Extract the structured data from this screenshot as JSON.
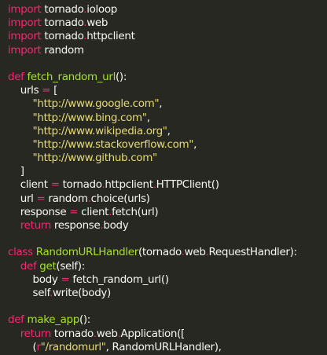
{
  "editor": {
    "theme_colors": {
      "background": "#272822",
      "text": "#f8f8f2",
      "keyword": "#f92672",
      "function": "#a6e22e",
      "string": "#e6db74"
    },
    "lines": [
      [
        [
          "kw",
          "import"
        ],
        [
          "txt",
          " tornado"
        ],
        [
          "dot",
          "."
        ],
        [
          "txt",
          "ioloop"
        ]
      ],
      [
        [
          "kw",
          "import"
        ],
        [
          "txt",
          " tornado"
        ],
        [
          "dot",
          "."
        ],
        [
          "txt",
          "web"
        ]
      ],
      [
        [
          "kw",
          "import"
        ],
        [
          "txt",
          " tornado"
        ],
        [
          "dot",
          "."
        ],
        [
          "txt",
          "httpclient"
        ]
      ],
      [
        [
          "kw",
          "import"
        ],
        [
          "txt",
          " random"
        ]
      ],
      [],
      [
        [
          "kw",
          "def"
        ],
        [
          "txt",
          " "
        ],
        [
          "fn",
          "fetch_random_url"
        ],
        [
          "txt",
          "():"
        ]
      ],
      [
        [
          "txt",
          "    urls "
        ],
        [
          "op",
          "="
        ],
        [
          "txt",
          " ["
        ]
      ],
      [
        [
          "txt",
          "        "
        ],
        [
          "str",
          "\"http://www.google.com\""
        ],
        [
          "txt",
          ","
        ]
      ],
      [
        [
          "txt",
          "        "
        ],
        [
          "str",
          "\"http://www.bing.com\""
        ],
        [
          "txt",
          ","
        ]
      ],
      [
        [
          "txt",
          "        "
        ],
        [
          "str",
          "\"http://www.wikipedia.org\""
        ],
        [
          "txt",
          ","
        ]
      ],
      [
        [
          "txt",
          "        "
        ],
        [
          "str",
          "\"http://www.stackoverflow.com\""
        ],
        [
          "txt",
          ","
        ]
      ],
      [
        [
          "txt",
          "        "
        ],
        [
          "str",
          "\"http://www.github.com\""
        ]
      ],
      [
        [
          "txt",
          "    ]"
        ]
      ],
      [
        [
          "txt",
          "    client "
        ],
        [
          "op",
          "="
        ],
        [
          "txt",
          " tornado"
        ],
        [
          "dot",
          "."
        ],
        [
          "txt",
          "httpclient"
        ],
        [
          "dot",
          "."
        ],
        [
          "txt",
          "HTTPClient()"
        ]
      ],
      [
        [
          "txt",
          "    url "
        ],
        [
          "op",
          "="
        ],
        [
          "txt",
          " random"
        ],
        [
          "dot",
          "."
        ],
        [
          "txt",
          "choice(urls)"
        ]
      ],
      [
        [
          "txt",
          "    response "
        ],
        [
          "op",
          "="
        ],
        [
          "txt",
          " client"
        ],
        [
          "dot",
          "."
        ],
        [
          "txt",
          "fetch(url)"
        ]
      ],
      [
        [
          "txt",
          "    "
        ],
        [
          "kw",
          "return"
        ],
        [
          "txt",
          " response"
        ],
        [
          "dot",
          "."
        ],
        [
          "txt",
          "body"
        ]
      ],
      [],
      [
        [
          "kw",
          "class"
        ],
        [
          "txt",
          " "
        ],
        [
          "fn",
          "RandomURLHandler"
        ],
        [
          "txt",
          "(tornado"
        ],
        [
          "dot",
          "."
        ],
        [
          "txt",
          "web"
        ],
        [
          "dot",
          "."
        ],
        [
          "txt",
          "RequestHandler):"
        ]
      ],
      [
        [
          "txt",
          "    "
        ],
        [
          "kw",
          "def"
        ],
        [
          "txt",
          " "
        ],
        [
          "fn",
          "get"
        ],
        [
          "txt",
          "(self):"
        ]
      ],
      [
        [
          "txt",
          "        body "
        ],
        [
          "op",
          "="
        ],
        [
          "txt",
          " fetch_random_url()"
        ]
      ],
      [
        [
          "txt",
          "        self"
        ],
        [
          "dot",
          "."
        ],
        [
          "txt",
          "write(body)"
        ]
      ],
      [],
      [
        [
          "kw",
          "def"
        ],
        [
          "txt",
          " "
        ],
        [
          "fn",
          "make_app"
        ],
        [
          "txt",
          "():"
        ]
      ],
      [
        [
          "txt",
          "    "
        ],
        [
          "kw",
          "return"
        ],
        [
          "txt",
          " tornado"
        ],
        [
          "dot",
          "."
        ],
        [
          "txt",
          "web"
        ],
        [
          "dot",
          "."
        ],
        [
          "txt",
          "Application(["
        ]
      ],
      [
        [
          "txt",
          "        ("
        ],
        [
          "kw",
          "r"
        ],
        [
          "str",
          "\"/randomurl\""
        ],
        [
          "txt",
          ", RandomURLHandler),"
        ]
      ],
      [
        [
          "txt",
          "    ])"
        ]
      ]
    ]
  }
}
